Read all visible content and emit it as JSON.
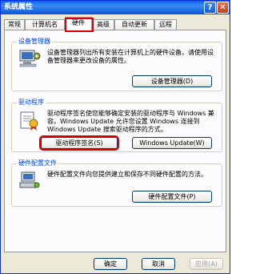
{
  "window": {
    "title": "系统属性"
  },
  "titlebar": {
    "help_label": "?",
    "close_label": "✕"
  },
  "tabs": [
    {
      "label": "常规"
    },
    {
      "label": "计算机名"
    },
    {
      "label": "硬件"
    },
    {
      "label": "高级"
    },
    {
      "label": "自动更新"
    },
    {
      "label": "远程"
    }
  ],
  "device_manager": {
    "title": "设备管理器",
    "text": "设备管理器列出所有安装在计算机上的硬件设备。请使用设备管理器来更改设备的属性。",
    "button": "设备管理器(D)",
    "icon": "device-manager-icon"
  },
  "drivers": {
    "title": "驱动程序",
    "text": "驱动程序签名使您能够确定安装的驱动程序与 Windows 兼容。Windows Update 允许您设置 Windows 连接到 Windows Update 搜索驱动程序的方式。",
    "signing_button": "驱动程序签名(S)",
    "update_button": "Windows Update(W)",
    "icon": "driver-signing-icon"
  },
  "hardware_profiles": {
    "title": "硬件配置文件",
    "text": "硬件配置文件向您提供建立和保存不同硬件配置的方法。",
    "button": "硬件配置文件(P)",
    "icon": "hardware-profile-icon"
  },
  "footer": {
    "ok": "确定",
    "cancel": "取消",
    "apply": "应用(A)"
  },
  "colors": {
    "titlebar": "#0a5fe8",
    "highlight": "#e00000",
    "group_title": "#0046d5"
  }
}
